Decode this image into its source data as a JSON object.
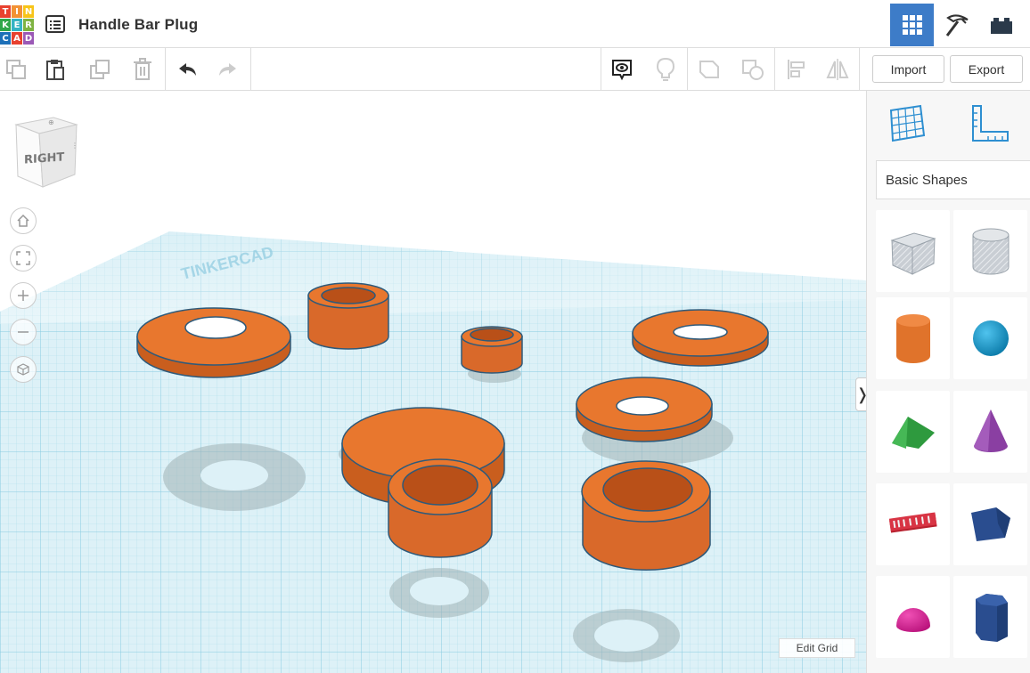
{
  "app": {
    "logo_letters": [
      "T",
      "I",
      "N",
      "K",
      "E",
      "R",
      "C",
      "A",
      "D"
    ],
    "logo_colors": [
      "#e8412f",
      "#f29235",
      "#f7c418",
      "#2fa64a",
      "#35b3c4",
      "#7fb342",
      "#1d70b8",
      "#e8412f",
      "#9b59b6"
    ],
    "project_title": "Handle Bar Plug",
    "views": {
      "active": "3d-design"
    }
  },
  "toolbar": {
    "import_label": "Import",
    "export_label": "Export"
  },
  "viewcube": {
    "face_label": "RIGHT"
  },
  "workplane": {
    "edit_grid_label": "Edit Grid",
    "grid_color": "#a8dbe8",
    "shape_color": "#e8772e"
  },
  "shapes_panel": {
    "category_label": "Basic Shapes",
    "shapes": [
      "box-hole",
      "cylinder-hole",
      "box",
      "cylinder",
      "sphere",
      "roof",
      "cone",
      "text",
      "polygon",
      "half-sphere",
      "hexagonal-prism"
    ]
  },
  "colors": {
    "accent": "#3d7cc8",
    "orange": "#e8772e",
    "panel_icon": "#2e8fd1"
  }
}
